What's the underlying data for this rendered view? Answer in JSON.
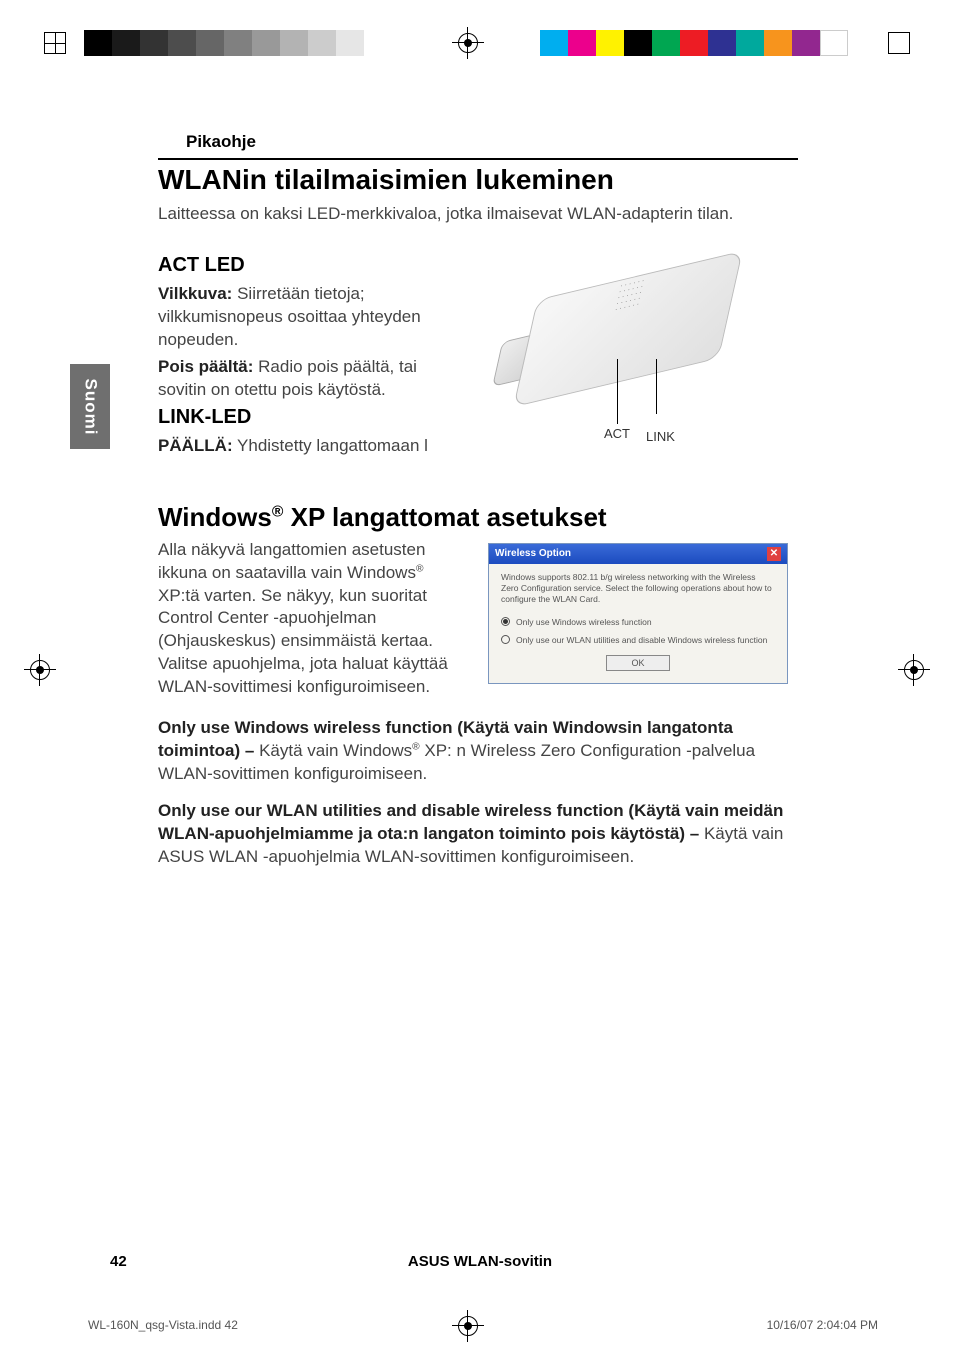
{
  "lang_tab": "Suomi",
  "header_small": "Pikaohje",
  "h1": "WLANin tilailmaisimien lukeminen",
  "intro": "Laitteessa on kaksi LED-merkkivaloa, jotka ilmaisevat WLAN-adapterin tilan.",
  "act": {
    "title": "ACT LED",
    "blink_label": "Vilkkuva:",
    "blink_text": "Siirretään tietoja; vilkkumisnopeus osoittaa yhteyden nopeuden.",
    "off_label": "Pois päältä:",
    "off_text": "Radio pois päältä, tai sovitin on otettu pois käytöstä."
  },
  "link": {
    "title": "LINK-LED",
    "on_label": "PÄÄLLÄ:",
    "on_text": "Yhdistetty langattomaan l"
  },
  "device_labels": {
    "act": "ACT",
    "link": "LINK"
  },
  "h1b_pre": "Windows",
  "h1b_sup": "®",
  "h1b_post": " XP langattomat asetukset",
  "xp_para_1": "Alla näkyvä langattomien asetusten ikkuna on saatavilla vain Windows",
  "xp_para_sup": "®",
  "xp_para_2": " XP:tä varten. Se näkyy, kun suoritat Control Center -apuohjelman (Ohjauskeskus) ensimmäistä kertaa. Valitse apuohjelma, jota haluat käyttää WLAN-sovittimesi konfiguroimiseen.",
  "dialog": {
    "title": "Wireless Option",
    "desc": "Windows supports 802.11 b/g wireless networking with the Wireless Zero Configuration service. Select the following operations about how to configure the WLAN Card.",
    "opt1": "Only use Windows wireless function",
    "opt2": "Only use our WLAN utilities and disable Windows wireless function",
    "ok": "OK"
  },
  "option1_bold": "Only use Windows wireless function (Käytä vain Windowsin langatonta toimintoa) –",
  "option1_pre": " Käytä vain Windows",
  "option1_sup": "®",
  "option1_post": " XP: n Wireless Zero Configuration -palvelua WLAN-sovittimen konfiguroimiseen.",
  "option2_bold": "Only use our WLAN utilities and disable wireless function (Käytä vain meidän WLAN-apuohjelmiamme ja ota:n langaton toiminto pois käytöstä) –",
  "option2_text": " Käytä vain ASUS WLAN -apuohjelmia WLAN-sovittimen konfiguroimiseen.",
  "footer": {
    "page": "42",
    "title": "ASUS WLAN-sovitin"
  },
  "print_meta": {
    "file": "WL-160N_qsg-Vista.indd   42",
    "stamp": "10/16/07   2:04:04 PM"
  },
  "colors": {
    "grays": [
      "#000000",
      "#1a1a1a",
      "#333333",
      "#4d4d4d",
      "#666666",
      "#808080",
      "#999999",
      "#b3b3b3",
      "#cccccc",
      "#e6e6e6"
    ],
    "hues": [
      "#00aeef",
      "#ec008c",
      "#fff200",
      "#000000",
      "#00a651",
      "#ed1c24",
      "#2e3192",
      "#00a99d",
      "#f7941d",
      "#92278f",
      "#ffffff"
    ]
  }
}
